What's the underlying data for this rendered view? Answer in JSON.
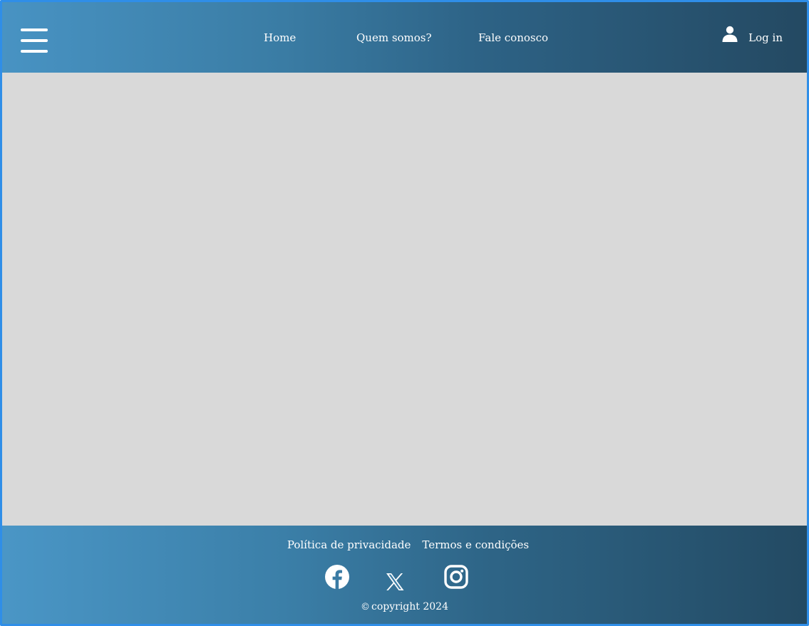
{
  "header": {
    "menu_icon": "hamburger-menu-icon",
    "nav": [
      {
        "label": "Home"
      },
      {
        "label": "Quem somos?"
      },
      {
        "label": "Fale conosco"
      }
    ],
    "login": {
      "icon": "user-icon",
      "label": "Log in"
    }
  },
  "footer": {
    "links": [
      {
        "label": "Política de privacidade"
      },
      {
        "label": "Termos e condições"
      }
    ],
    "social": [
      {
        "icon": "facebook-icon"
      },
      {
        "icon": "x-twitter-icon"
      },
      {
        "icon": "instagram-icon"
      }
    ],
    "copyright_symbol": "©",
    "copyright": "copyright 2024"
  },
  "colors": {
    "border": "#2f8ee8",
    "header_gradient_start": "#4893c3",
    "header_gradient_end": "#244962",
    "content_background": "#d9d9d9",
    "text": "#ffffff"
  }
}
